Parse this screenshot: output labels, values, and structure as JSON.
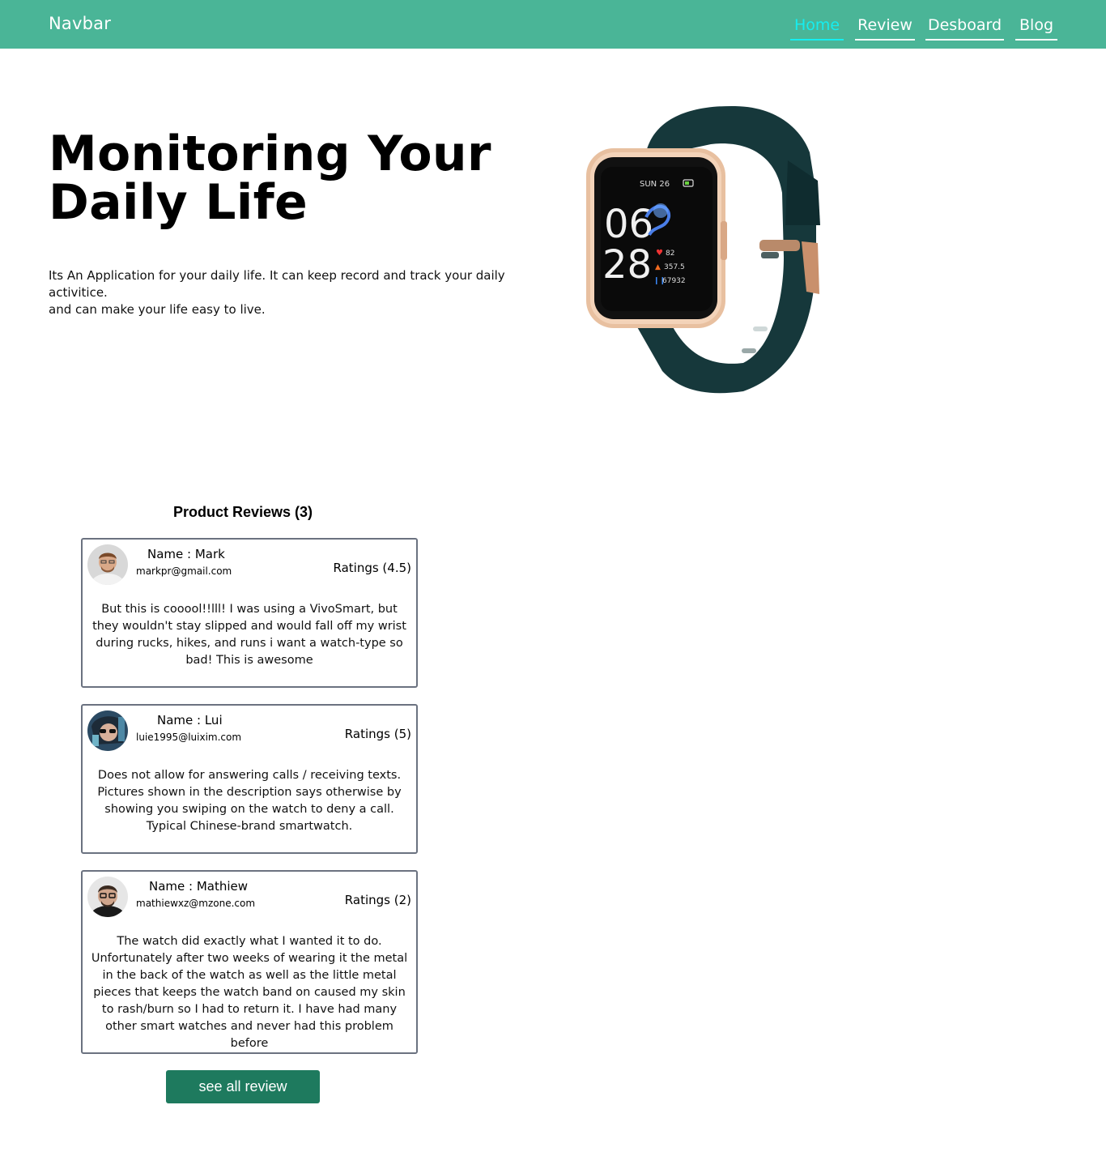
{
  "navbar": {
    "brand": "Navbar",
    "links": [
      {
        "label": "Home",
        "active": true
      },
      {
        "label": "Review",
        "active": false
      },
      {
        "label": "Desboard",
        "active": false
      },
      {
        "label": "Blog",
        "active": false
      }
    ]
  },
  "hero": {
    "title_line1": "Monitoring Your",
    "title_line2": "Daily Life",
    "description_line1": "Its An Application for your daily life. It can keep record and track your daily activitice.",
    "description_line2": "and can make your life easy to live."
  },
  "watch_screen": {
    "date": "SUN 26",
    "hour": "06",
    "minute": "28",
    "heart_rate": "82",
    "calories": "357.5",
    "steps": "67932"
  },
  "reviews": {
    "heading": "Product Reviews (3)",
    "items": [
      {
        "name": "Name : Mark",
        "email": "markpr@gmail.com",
        "rating": "Ratings (4.5)",
        "comment": "But this is cooool!!lll! I was using a VivoSmart, but they wouldn't stay slipped and would fall off my wrist during rucks, hikes, and runs i want a watch-type so bad! This is awesome"
      },
      {
        "name": "Name : Lui",
        "email": "luie1995@luixim.com",
        "rating": "Ratings (5)",
        "comment": "Does not allow for answering calls / receiving texts. Pictures shown in the description says otherwise by showing you swiping on the watch to deny a call. Typical Chinese-brand smartwatch."
      },
      {
        "name": "Name : Mathiew",
        "email": "mathiewxz@mzone.com",
        "rating": "Ratings (2)",
        "comment": "The watch did exactly what I wanted it to do. Unfortunately after two weeks of wearing it the metal in the back of the watch as well as the little metal pieces that keeps the watch band on caused my skin to rash/burn so I had to return it. I have had many other smart watches and never had this problem before"
      }
    ],
    "button_label": "see all review"
  },
  "colors": {
    "navbar_bg": "#4ab597",
    "nav_active": "#15eef0",
    "button_bg": "#1e7a5e",
    "watch_band": "#16383b",
    "watch_case": "#e8c0a0"
  }
}
